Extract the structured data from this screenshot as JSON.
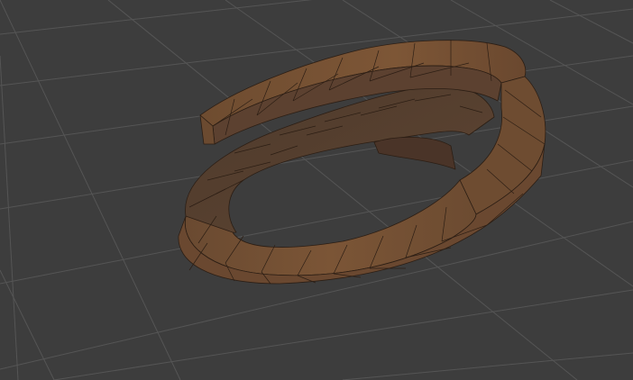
{
  "viewport": {
    "background_color": "#3d3d3d",
    "grid_color": "#5a5a5a",
    "object": {
      "kind": "open-ring-mesh",
      "shading": "flat",
      "wireframe": true,
      "face_color_light": "#7a5636",
      "face_color_mid": "#6b4a30",
      "face_color_dark": "#4b3426",
      "edge_color": "#2c1e14"
    }
  }
}
